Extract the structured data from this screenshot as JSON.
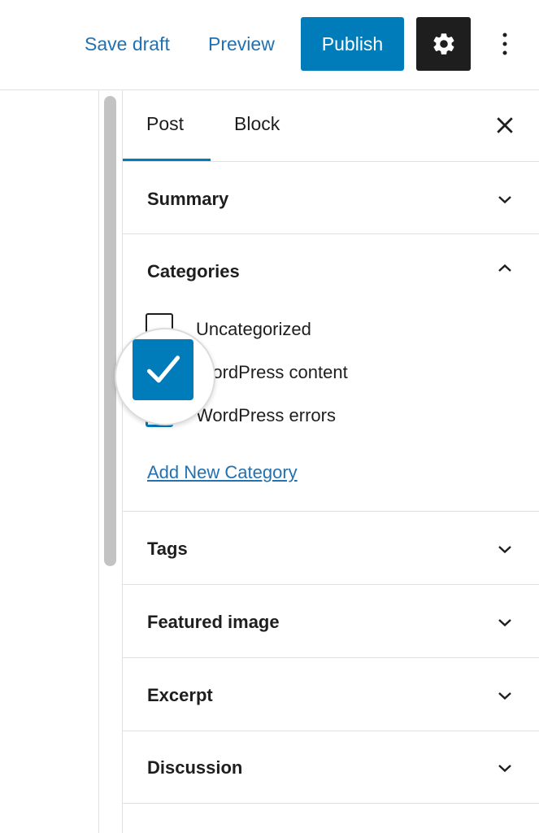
{
  "toolbar": {
    "save_draft": "Save draft",
    "preview": "Preview",
    "publish": "Publish",
    "settings_icon": "gear-icon",
    "more_icon": "vertical-ellipsis-icon"
  },
  "sidebar": {
    "tabs": [
      {
        "label": "Post",
        "active": true
      },
      {
        "label": "Block",
        "active": false
      }
    ],
    "close_icon": "close-icon",
    "panels": {
      "summary": {
        "title": "Summary",
        "expanded": false
      },
      "categories": {
        "title": "Categories",
        "expanded": true,
        "items": [
          {
            "label": "Uncategorized",
            "checked": false
          },
          {
            "label": "WordPress content",
            "checked": true
          },
          {
            "label": "WordPress errors",
            "checked": false
          }
        ],
        "add_new": "Add New Category"
      },
      "tags": {
        "title": "Tags",
        "expanded": false
      },
      "featured_image": {
        "title": "Featured image",
        "expanded": false
      },
      "excerpt": {
        "title": "Excerpt",
        "expanded": false
      },
      "discussion": {
        "title": "Discussion",
        "expanded": false
      }
    }
  },
  "colors": {
    "accent": "#007cba",
    "link": "#2271b1",
    "dark": "#1e1e1e",
    "border": "#e0e0e0"
  }
}
